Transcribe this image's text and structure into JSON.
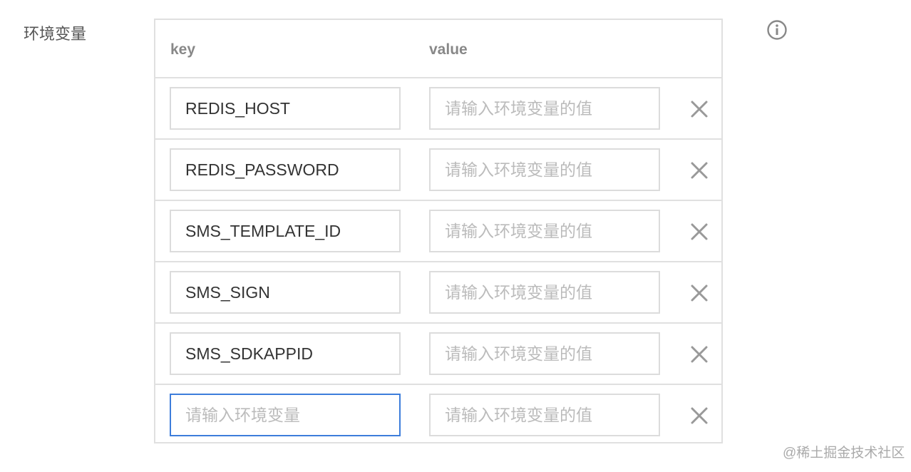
{
  "form": {
    "label": "环境变量"
  },
  "table": {
    "key_header": "key",
    "value_header": "value",
    "rows": [
      {
        "key": "REDIS_HOST",
        "key_placeholder": "",
        "value": "",
        "value_placeholder": "请输入环境变量的值"
      },
      {
        "key": "REDIS_PASSWORD",
        "key_placeholder": "",
        "value": "",
        "value_placeholder": "请输入环境变量的值"
      },
      {
        "key": "SMS_TEMPLATE_ID",
        "key_placeholder": "",
        "value": "",
        "value_placeholder": "请输入环境变量的值"
      },
      {
        "key": "SMS_SIGN",
        "key_placeholder": "",
        "value": "",
        "value_placeholder": "请输入环境变量的值"
      },
      {
        "key": "SMS_SDKAPPID",
        "key_placeholder": "",
        "value": "",
        "value_placeholder": "请输入环境变量的值"
      },
      {
        "key": "",
        "key_placeholder": "请输入环境变量",
        "value": "",
        "value_placeholder": "请输入环境变量的值"
      }
    ]
  },
  "icons": {
    "delete": "close-icon",
    "info": "info-icon"
  },
  "colors": {
    "focus_border": "#3d7ddb",
    "border": "#e0e0e0",
    "icon": "#999999"
  },
  "watermark": "@稀土掘金技术社区"
}
